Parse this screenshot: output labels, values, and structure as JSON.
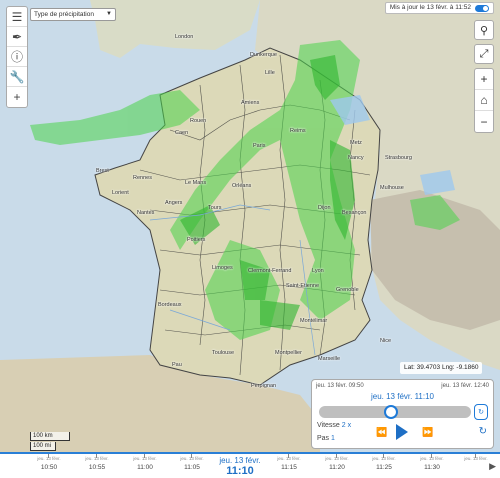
{
  "toolbar": {
    "precip_type_label": "Type de précipitation"
  },
  "update": {
    "label": "Mis à jour le 13 févr. à 11:52"
  },
  "coords": "Lat: 39.4703  Lng: -9.1860",
  "scale": {
    "km": "100 km",
    "mi": "100 mi"
  },
  "player": {
    "start": "jeu. 13 févr. 09:50",
    "end": "jeu. 13 févr. 12:40",
    "current": "jeu. 13 févr.  11:10",
    "speed_label": "Vitesse",
    "speed_value": "2 x",
    "step_label": "Pas",
    "step_value": "1",
    "progress": 0.47
  },
  "timeline": {
    "ticks": [
      {
        "d": "jeu. 13 févr.",
        "h": "10:50"
      },
      {
        "d": "jeu. 13 févr.",
        "h": "10:55"
      },
      {
        "d": "jeu. 13 févr.",
        "h": "11:00"
      },
      {
        "d": "jeu. 13 févr.",
        "h": "11:05"
      },
      {
        "d": "jeu. 13 févr.",
        "h": "11:15"
      },
      {
        "d": "jeu. 13 févr.",
        "h": "11:20"
      },
      {
        "d": "jeu. 13 févr.",
        "h": "11:25"
      },
      {
        "d": "jeu. 13 févr.",
        "h": "11:30"
      },
      {
        "d": "jeu. 13 févr.",
        "h": ""
      }
    ],
    "current_date": "jeu. 13 févr.",
    "current_time": "11:10"
  },
  "cities": [
    {
      "name": "London"
    },
    {
      "name": "Dunkerque"
    },
    {
      "name": "Lille"
    },
    {
      "name": "Amiens"
    },
    {
      "name": "Caen"
    },
    {
      "name": "Rouen"
    },
    {
      "name": "Paris"
    },
    {
      "name": "Reims"
    },
    {
      "name": "Metz"
    },
    {
      "name": "Strasbourg"
    },
    {
      "name": "Rennes"
    },
    {
      "name": "Le Mans"
    },
    {
      "name": "Orléans"
    },
    {
      "name": "Nantes"
    },
    {
      "name": "Angers"
    },
    {
      "name": "Tours"
    },
    {
      "name": "Dijon"
    },
    {
      "name": "Besançon"
    },
    {
      "name": "Mulhouse"
    },
    {
      "name": "Poitiers"
    },
    {
      "name": "Limoges"
    },
    {
      "name": "Clermont-Ferrand"
    },
    {
      "name": "Lyon"
    },
    {
      "name": "Grenoble"
    },
    {
      "name": "Saint-Etienne"
    },
    {
      "name": "Bordeaux"
    },
    {
      "name": "Toulouse"
    },
    {
      "name": "Montpellier"
    },
    {
      "name": "Marseille"
    },
    {
      "name": "Perpignan"
    },
    {
      "name": "Pau"
    },
    {
      "name": "Nice"
    },
    {
      "name": "Montélimar"
    },
    {
      "name": "Brest"
    },
    {
      "name": "Lorient"
    },
    {
      "name": "Nancy"
    }
  ]
}
